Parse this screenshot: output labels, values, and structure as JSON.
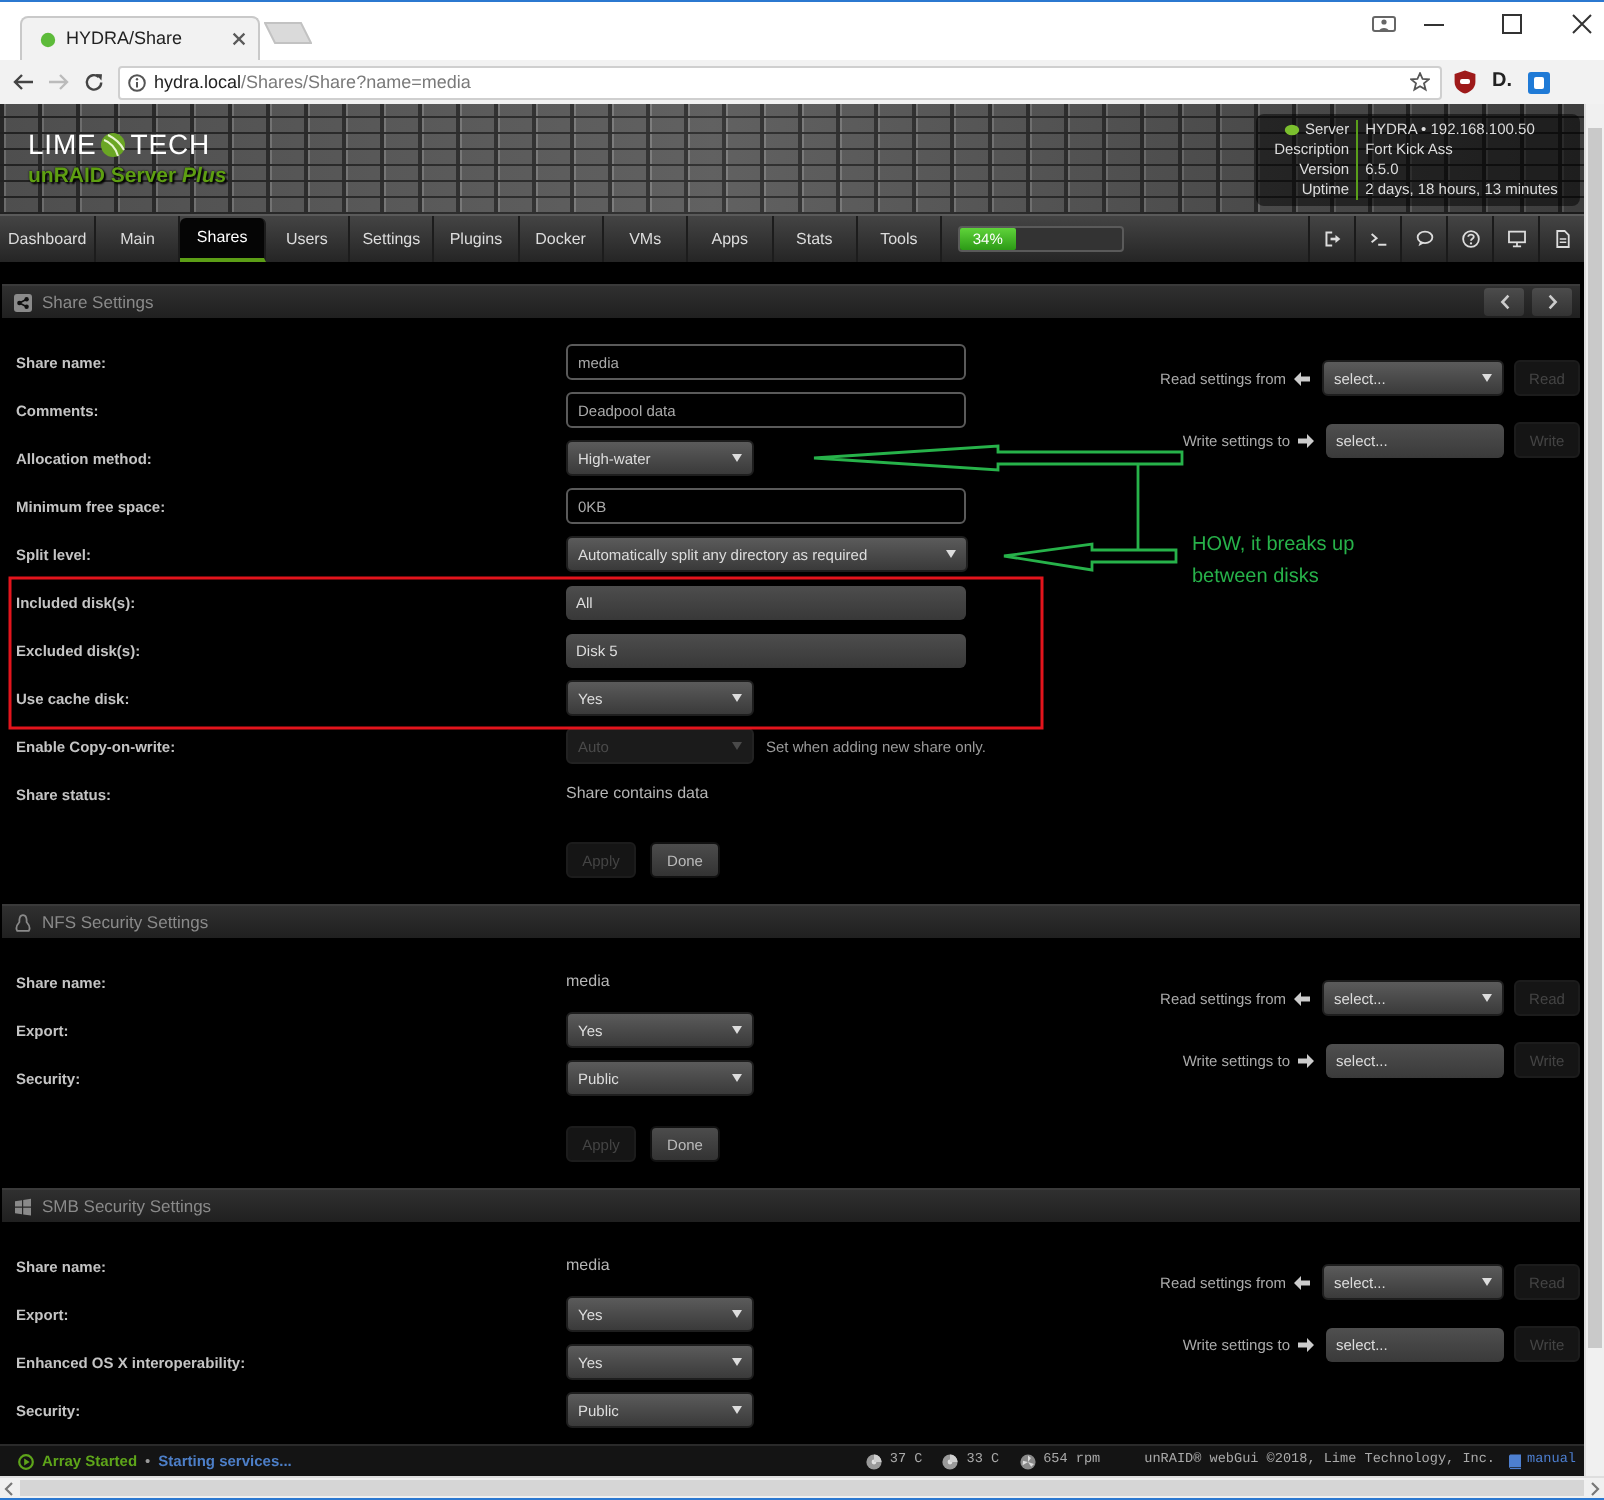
{
  "browser": {
    "tab_title": "HYDRA/Share",
    "url_host": "hydra.local",
    "url_path": "/Shares/Share?name=media",
    "extensions": [
      {
        "kind": "shield"
      },
      {
        "kind": "letter",
        "label": "D."
      },
      {
        "kind": "tile"
      }
    ]
  },
  "header": {
    "logo_left": "LIME",
    "logo_right": "TECH",
    "tagline": "unRAID Server *Plus*",
    "server_info": [
      {
        "label": "Server",
        "value": "HYDRA • 192.168.100.50"
      },
      {
        "label": "Description",
        "value": "Fort Kick Ass"
      },
      {
        "label": "Version",
        "value": "6.5.0"
      },
      {
        "label": "Uptime",
        "value": "2 days, 18 hours, 13 minutes"
      }
    ]
  },
  "nav": {
    "tabs": [
      {
        "label": "Dashboard",
        "selected": false
      },
      {
        "label": "Main",
        "selected": false
      },
      {
        "label": "Shares",
        "selected": true
      },
      {
        "label": "Users",
        "selected": false
      },
      {
        "label": "Settings",
        "selected": false
      },
      {
        "label": "Plugins",
        "selected": false
      },
      {
        "label": "Docker",
        "selected": false
      },
      {
        "label": "VMs",
        "selected": false
      },
      {
        "label": "Apps",
        "selected": false
      },
      {
        "label": "Stats",
        "selected": false
      },
      {
        "label": "Tools",
        "selected": false
      }
    ],
    "progress": {
      "level": 0.34,
      "reading": "34%"
    }
  },
  "sections": [
    {
      "kind": "share",
      "title": "Share Settings",
      "pager": true,
      "fields": [
        {
          "kind": "text",
          "label": "Share name:",
          "value": "media",
          "disabled": false
        },
        {
          "kind": "text",
          "label": "Comments:",
          "value": "Deadpool data",
          "disabled": false
        },
        {
          "kind": "select",
          "label": "Allocation method:",
          "value": "High-water",
          "disabled": false
        },
        {
          "kind": "text",
          "label": "Minimum free space:",
          "value": "0KB",
          "disabled": false
        },
        {
          "kind": "wideselect",
          "label": "Split level:",
          "value": "Automatically split any directory as required",
          "disabled": false
        },
        {
          "kind": "picker",
          "label": "Included disk(s):",
          "value": "All",
          "disabled": false
        },
        {
          "kind": "picker",
          "label": "Excluded disk(s):",
          "value": "Disk 5",
          "disabled": false
        },
        {
          "kind": "select",
          "label": "Use cache disk:",
          "value": "Yes",
          "disabled": false
        },
        {
          "kind": "select",
          "label": "Enable Copy-on-write:",
          "value": "Auto",
          "disabled": true,
          "note": "Set when adding new share only."
        },
        {
          "kind": "static",
          "label": "Share status:",
          "value": "Share contains data",
          "disabled": false
        }
      ],
      "buttons": [
        {
          "label": "Apply",
          "disabled": true
        },
        {
          "label": "Done",
          "disabled": false
        }
      ],
      "copy": {
        "read_label": "Read settings from",
        "read_value": "select...",
        "read_button": {
          "label": "Read",
          "disabled": true
        },
        "write_label": "Write settings to",
        "write_value": "select...",
        "write_button": {
          "label": "Write",
          "disabled": true
        }
      }
    },
    {
      "kind": "nfs",
      "title": "NFS Security Settings",
      "fields": [
        {
          "kind": "static",
          "label": "Share name:",
          "value": "media",
          "disabled": false
        },
        {
          "kind": "select",
          "label": "Export:",
          "value": "Yes",
          "disabled": false
        },
        {
          "kind": "select",
          "label": "Security:",
          "value": "Public",
          "disabled": false
        }
      ],
      "buttons": [
        {
          "label": "Apply",
          "disabled": true
        },
        {
          "label": "Done",
          "disabled": false
        }
      ],
      "copy": {
        "read_label": "Read settings from",
        "read_value": "select...",
        "read_button": {
          "label": "Read",
          "disabled": true
        },
        "write_label": "Write settings to",
        "write_value": "select...",
        "write_button": {
          "label": "Write",
          "disabled": true
        }
      }
    },
    {
      "kind": "smb",
      "title": "SMB Security Settings",
      "fields": [
        {
          "kind": "static",
          "label": "Share name:",
          "value": "media",
          "disabled": false
        },
        {
          "kind": "select",
          "label": "Export:",
          "value": "Yes",
          "disabled": false
        },
        {
          "kind": "select",
          "label": "Enhanced OS X interoperability:",
          "value": "Yes",
          "disabled": false
        },
        {
          "kind": "select",
          "label": "Security:",
          "value": "Public",
          "disabled": false
        }
      ],
      "copy": {
        "read_label": "Read settings from",
        "read_value": "select...",
        "read_button": {
          "label": "Read",
          "disabled": true
        },
        "write_label": "Write settings to",
        "write_value": "select...",
        "write_button": {
          "label": "Write",
          "disabled": true
        }
      }
    }
  ],
  "annotation": {
    "text": "HOW, it breaks up between disks"
  },
  "status_bar": {
    "array_state": "Array Started",
    "separator": "•",
    "activity": "Starting services...",
    "readings": [
      {
        "kind": "temperature",
        "text": "37 C"
      },
      {
        "kind": "temperature",
        "text": "33 C"
      },
      {
        "kind": "fan",
        "text": "654 rpm"
      }
    ],
    "copyright": "unRAID® webGui ©2018, Lime Technology, Inc.",
    "manual": "manual"
  }
}
